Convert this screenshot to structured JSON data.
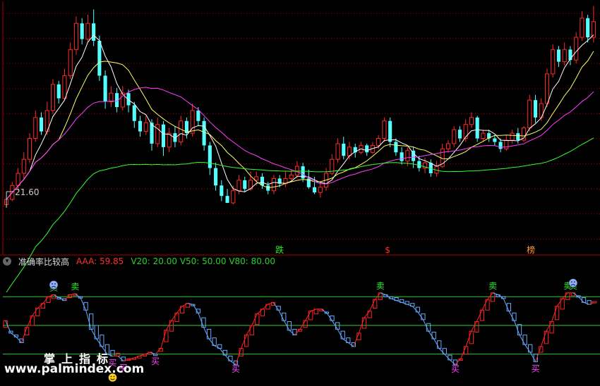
{
  "indicator": {
    "collapse_icon": "chevron-down-icon",
    "name": "准确率比较高",
    "aaa": "AAA: 59.85",
    "levels": "V20: 20.00  V50: 50.00  V80: 80.00"
  },
  "main_panel": {
    "low_label": "21.60",
    "signals": [
      "跌",
      "$",
      "榜"
    ]
  },
  "sub_panel": {
    "sell_label": "卖",
    "buy_label": "买"
  },
  "brand": "掌上指标",
  "watermark": "www.palmindex.com",
  "colors": {
    "up": "#ff2a2a",
    "down": "#54ffff",
    "ma5": "#ffffff",
    "ma10": "#ffff66",
    "ma20": "#ff40ff",
    "ma60": "#33ff33",
    "grid": "#aa0000",
    "level_line": "#33cc33",
    "osc_up": "#ff2222",
    "osc_down": "#66aaff",
    "sell": "#22ee22",
    "buy": "#ff44ff"
  },
  "chart_data": [
    {
      "type": "candlestick",
      "title": "",
      "ylim": [
        19.5,
        33
      ],
      "candles": [
        [
          21.5,
          21.8,
          21.4,
          21.9
        ],
        [
          21.8,
          22.6,
          21.7,
          22.8
        ],
        [
          22.6,
          23.3,
          22.3,
          23.6
        ],
        [
          23.3,
          24.1,
          23.0,
          24.5
        ],
        [
          24.1,
          25.3,
          23.9,
          25.6
        ],
        [
          25.3,
          26.5,
          25.1,
          26.9
        ],
        [
          26.5,
          25.7,
          25.5,
          26.8
        ],
        [
          25.7,
          26.9,
          25.5,
          27.4
        ],
        [
          26.9,
          28.4,
          26.7,
          28.7
        ],
        [
          28.4,
          27.6,
          27.3,
          28.6
        ],
        [
          27.6,
          28.9,
          27.5,
          29.3
        ],
        [
          28.9,
          30.4,
          28.7,
          30.8
        ],
        [
          30.4,
          31.9,
          30.1,
          32.3
        ],
        [
          31.9,
          31.0,
          30.7,
          32.2
        ],
        [
          31.0,
          31.9,
          30.8,
          32.4
        ],
        [
          31.9,
          30.9,
          30.6,
          32.7
        ],
        [
          30.9,
          28.9,
          28.6,
          31.2
        ],
        [
          28.9,
          27.4,
          27.0,
          29.2
        ],
        [
          27.4,
          27.9,
          27.1,
          28.3
        ],
        [
          27.9,
          27.1,
          26.8,
          28.2
        ],
        [
          27.1,
          27.9,
          26.9,
          28.3
        ],
        [
          27.9,
          27.2,
          26.8,
          28.1
        ],
        [
          27.2,
          26.3,
          25.9,
          27.4
        ],
        [
          26.3,
          25.7,
          25.4,
          26.6
        ],
        [
          25.7,
          26.2,
          25.5,
          26.6
        ],
        [
          26.2,
          25.0,
          24.6,
          26.4
        ],
        [
          25.0,
          26.1,
          24.8,
          26.5
        ],
        [
          26.1,
          24.8,
          24.3,
          26.3
        ],
        [
          24.8,
          25.6,
          24.5,
          25.9
        ],
        [
          25.6,
          25.1,
          24.8,
          26.0
        ],
        [
          25.1,
          26.3,
          24.9,
          26.6
        ],
        [
          26.3,
          25.6,
          25.3,
          26.5
        ],
        [
          25.6,
          26.9,
          25.4,
          27.3
        ],
        [
          26.9,
          26.3,
          26.0,
          27.1
        ],
        [
          26.3,
          24.9,
          24.6,
          26.5
        ],
        [
          24.9,
          23.6,
          23.2,
          25.1
        ],
        [
          23.6,
          22.6,
          22.3,
          23.9
        ],
        [
          22.6,
          22.0,
          21.7,
          22.9
        ],
        [
          22.0,
          21.6,
          21.6,
          22.4
        ],
        [
          21.6,
          22.3,
          21.5,
          22.6
        ],
        [
          22.3,
          22.9,
          22.1,
          23.2
        ],
        [
          22.9,
          22.4,
          22.2,
          23.1
        ],
        [
          22.4,
          22.9,
          22.3,
          23.4
        ],
        [
          22.9,
          23.1,
          22.6,
          23.4
        ],
        [
          23.1,
          22.6,
          22.4,
          23.3
        ],
        [
          22.6,
          22.3,
          22.1,
          22.8
        ],
        [
          22.3,
          23.0,
          22.1,
          23.2
        ],
        [
          23.0,
          22.7,
          22.5,
          23.2
        ],
        [
          22.7,
          23.0,
          22.5,
          23.4
        ],
        [
          23.0,
          23.2,
          22.8,
          23.5
        ],
        [
          23.2,
          23.7,
          23.0,
          24.0
        ],
        [
          23.7,
          23.0,
          22.8,
          23.9
        ],
        [
          23.0,
          22.5,
          22.4,
          23.5
        ],
        [
          22.5,
          22.2,
          22.1,
          23.1
        ],
        [
          22.2,
          22.5,
          21.9,
          22.8
        ],
        [
          22.5,
          23.3,
          22.3,
          23.6
        ],
        [
          23.3,
          24.1,
          23.2,
          24.4
        ],
        [
          24.1,
          25.0,
          23.9,
          25.3
        ],
        [
          25.0,
          24.3,
          24.1,
          25.4
        ],
        [
          24.3,
          24.8,
          24.1,
          25.1
        ],
        [
          24.8,
          24.5,
          24.2,
          25.0
        ],
        [
          24.5,
          24.9,
          24.4,
          25.1
        ],
        [
          24.9,
          24.5,
          24.3,
          25.0
        ],
        [
          24.5,
          24.9,
          24.4,
          25.1
        ],
        [
          24.9,
          25.3,
          24.7,
          25.5
        ],
        [
          25.3,
          26.3,
          25.1,
          26.5
        ],
        [
          26.3,
          25.1,
          24.8,
          26.5
        ],
        [
          25.1,
          24.5,
          24.3,
          25.3
        ],
        [
          24.5,
          24.0,
          23.8,
          24.8
        ],
        [
          24.0,
          24.6,
          23.7,
          24.8
        ],
        [
          24.6,
          24.0,
          23.6,
          24.8
        ],
        [
          24.0,
          23.6,
          23.4,
          24.3
        ],
        [
          23.6,
          23.9,
          23.3,
          24.2
        ],
        [
          23.9,
          23.3,
          23.1,
          24.1
        ],
        [
          23.3,
          23.7,
          23.1,
          24.0
        ],
        [
          23.7,
          24.7,
          23.6,
          25.0
        ],
        [
          24.7,
          25.0,
          24.5,
          25.2
        ],
        [
          25.0,
          25.8,
          24.8,
          26.0
        ],
        [
          25.8,
          25.3,
          25.1,
          26.0
        ],
        [
          25.3,
          26.1,
          25.1,
          26.4
        ],
        [
          26.1,
          26.5,
          25.9,
          26.8
        ],
        [
          26.5,
          25.3,
          25.1,
          26.6
        ],
        [
          25.3,
          25.6,
          25.1,
          25.8
        ],
        [
          25.6,
          25.3,
          25.1,
          25.8
        ],
        [
          25.3,
          25.1,
          24.9,
          25.5
        ],
        [
          25.1,
          24.7,
          24.5,
          25.3
        ],
        [
          24.7,
          25.2,
          24.6,
          25.5
        ],
        [
          25.2,
          25.6,
          25.0,
          25.8
        ],
        [
          25.6,
          25.2,
          25.0,
          25.9
        ],
        [
          25.2,
          25.9,
          25.1,
          26.0
        ],
        [
          25.9,
          27.5,
          25.7,
          27.8
        ],
        [
          27.5,
          26.5,
          26.2,
          27.8
        ],
        [
          26.5,
          27.3,
          26.3,
          27.6
        ],
        [
          27.3,
          29.0,
          27.1,
          29.3
        ],
        [
          29.0,
          30.4,
          28.8,
          30.7
        ],
        [
          30.4,
          29.7,
          29.4,
          30.6
        ],
        [
          29.7,
          30.4,
          29.5,
          30.8
        ],
        [
          30.4,
          29.8,
          29.5,
          30.6
        ],
        [
          29.8,
          31.1,
          29.6,
          31.4
        ],
        [
          31.1,
          32.2,
          30.9,
          32.6
        ],
        [
          32.2,
          31.1,
          30.8,
          32.4
        ],
        [
          31.1,
          32.0,
          30.8,
          32.9
        ]
      ]
    },
    {
      "type": "line",
      "title": "",
      "ylim": [
        0,
        100
      ],
      "series": [
        {
          "values": [
            55,
            42,
            38,
            32,
            48,
            60,
            68,
            73,
            80,
            82,
            79,
            76,
            82,
            83,
            79,
            66,
            46,
            36,
            28,
            20,
            18,
            18,
            13,
            14,
            16,
            18,
            20,
            22,
            20,
            26,
            45,
            55,
            63,
            70,
            73,
            72,
            63,
            48,
            36,
            29,
            26,
            19,
            13,
            9,
            26,
            40,
            50,
            62,
            67,
            72,
            74,
            66,
            55,
            45,
            40,
            46,
            55,
            65,
            67,
            67,
            63,
            55,
            46,
            36,
            32,
            28,
            42,
            58,
            65,
            77,
            84,
            82,
            78,
            76,
            74,
            72,
            70,
            64,
            56,
            44,
            36,
            26,
            20,
            14,
            9,
            15,
            28,
            44,
            54,
            66,
            77,
            84,
            82,
            78,
            65,
            55,
            40,
            30,
            22,
            12,
            28,
            44,
            54,
            70,
            78,
            84,
            84,
            80,
            74,
            72,
            74
          ]
        },
        {
          "values": [
            48,
            44,
            40,
            36,
            40,
            50,
            60,
            68,
            74,
            78,
            79,
            78,
            79,
            81,
            80,
            74,
            62,
            50,
            40,
            30,
            24,
            21,
            17,
            15,
            15,
            16,
            18,
            20,
            20,
            23,
            33,
            44,
            54,
            63,
            69,
            71,
            67,
            58,
            46,
            37,
            30,
            24,
            18,
            13,
            18,
            28,
            40,
            51,
            60,
            67,
            71,
            70,
            63,
            54,
            46,
            44,
            48,
            56,
            62,
            65,
            64,
            60,
            53,
            44,
            37,
            32,
            35,
            47,
            58,
            68,
            77,
            80,
            80,
            79,
            77,
            75,
            73,
            69,
            62,
            52,
            43,
            34,
            26,
            19,
            14,
            14,
            20,
            31,
            43,
            55,
            66,
            75,
            80,
            80,
            73,
            63,
            51,
            40,
            30,
            20,
            22,
            31,
            42,
            56,
            67,
            77,
            81,
            81,
            79,
            76,
            75
          ]
        }
      ],
      "levels": [
        20,
        50,
        80
      ]
    }
  ]
}
